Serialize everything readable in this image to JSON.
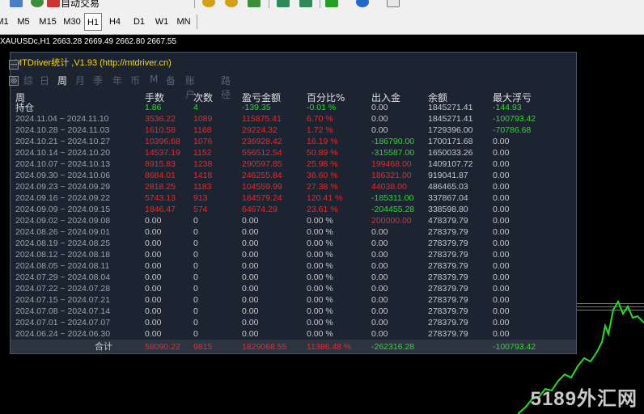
{
  "toolbar": {
    "auto_trading_label": "自动交易",
    "timeframes": [
      "M1",
      "M5",
      "M15",
      "M30",
      "H1",
      "H4",
      "D1",
      "W1",
      "MN"
    ],
    "active_timeframe": "H1",
    "icons": [
      "user-icon",
      "globe-icon",
      "zoom-in-icon",
      "zoom-out-icon",
      "tile-windows-icon",
      "period-separator-icon",
      "chart-shift-icon",
      "add-indicator-icon",
      "clock-icon",
      "template-icon"
    ]
  },
  "chart": {
    "title": "XAUUSDc,H1  2663.28 2669.49 2662.80 2667.55",
    "watermark": "5189外汇网"
  },
  "panel": {
    "title": "MTDriver统计 ,V1.93 (http://mtdriver.cn)",
    "tabs": [
      "综",
      "日",
      "周",
      "月",
      "季",
      "年",
      "币",
      "M",
      "备",
      "账户",
      "路径"
    ],
    "active_tab": "周",
    "headers": [
      "周",
      "手数",
      "次数",
      "盈亏金额",
      "百分比%",
      "出入金",
      "余额",
      "最大浮亏"
    ],
    "holding": {
      "label": "持仓",
      "lots": "1.86",
      "count": "4",
      "pnl": "-139.35",
      "pct": "-0.01 %",
      "flow": "0.00",
      "balance": "1845271.41",
      "maxdd": "-144.93"
    },
    "rows": [
      {
        "week": "2024.11.04 ~ 2024.11.10",
        "lots": "3536.22",
        "count": "1089",
        "pnl": "115875.41",
        "pct": "6.70 %",
        "flow": "0.00",
        "balance": "1845271.41",
        "maxdd": "-100793.42"
      },
      {
        "week": "2024.10.28 ~ 2024.11.03",
        "lots": "1610.58",
        "count": "1168",
        "pnl": "29224.32",
        "pct": "1.72 %",
        "flow": "0.00",
        "balance": "1729396.00",
        "maxdd": "-70786.68"
      },
      {
        "week": "2024.10.21 ~ 2024.10.27",
        "lots": "10396.68",
        "count": "1076",
        "pnl": "236928.42",
        "pct": "16.19 %",
        "flow": "-186790.00",
        "balance": "1700171.68",
        "maxdd": "0.00"
      },
      {
        "week": "2024.10.14 ~ 2024.10.20",
        "lots": "14537.19",
        "count": "1152",
        "pnl": "556512.54",
        "pct": "50.89 %",
        "flow": "-315587.00",
        "balance": "1650033.26",
        "maxdd": "0.00"
      },
      {
        "week": "2024.10.07 ~ 2024.10.13",
        "lots": "8915.83",
        "count": "1238",
        "pnl": "290597.85",
        "pct": "25.98 %",
        "flow": "199468.00",
        "balance": "1409107.72",
        "maxdd": "0.00"
      },
      {
        "week": "2024.09.30 ~ 2024.10.06",
        "lots": "8684.01",
        "count": "1418",
        "pnl": "246255.84",
        "pct": "36.60 %",
        "flow": "186321.00",
        "balance": "919041.87",
        "maxdd": "0.00"
      },
      {
        "week": "2024.09.23 ~ 2024.09.29",
        "lots": "2818.25",
        "count": "1183",
        "pnl": "104559.99",
        "pct": "27.38 %",
        "flow": "44038.00",
        "balance": "486465.03",
        "maxdd": "0.00"
      },
      {
        "week": "2024.09.16 ~ 2024.09.22",
        "lots": "5743.13",
        "count": "913",
        "pnl": "184579.24",
        "pct": "120.41 %",
        "flow": "-185311.00",
        "balance": "337867.04",
        "maxdd": "0.00"
      },
      {
        "week": "2024.09.09 ~ 2024.09.15",
        "lots": "1846.47",
        "count": "574",
        "pnl": "64674.29",
        "pct": "23.61 %",
        "flow": "-204455.28",
        "balance": "338598.80",
        "maxdd": "0.00"
      },
      {
        "week": "2024.09.02 ~ 2024.09.08",
        "lots": "0.00",
        "count": "0",
        "pnl": "0.00",
        "pct": "0.00 %",
        "flow": "200000.00",
        "balance": "478379.79",
        "maxdd": "0.00"
      },
      {
        "week": "2024.08.26 ~ 2024.09.01",
        "lots": "0.00",
        "count": "0",
        "pnl": "0.00",
        "pct": "0.00 %",
        "flow": "0.00",
        "balance": "278379.79",
        "maxdd": "0.00"
      },
      {
        "week": "2024.08.19 ~ 2024.08.25",
        "lots": "0.00",
        "count": "0",
        "pnl": "0.00",
        "pct": "0.00 %",
        "flow": "0.00",
        "balance": "278379.79",
        "maxdd": "0.00"
      },
      {
        "week": "2024.08.12 ~ 2024.08.18",
        "lots": "0.00",
        "count": "0",
        "pnl": "0.00",
        "pct": "0.00 %",
        "flow": "0.00",
        "balance": "278379.79",
        "maxdd": "0.00"
      },
      {
        "week": "2024.08.05 ~ 2024.08.11",
        "lots": "0.00",
        "count": "0",
        "pnl": "0.00",
        "pct": "0.00 %",
        "flow": "0.00",
        "balance": "278379.79",
        "maxdd": "0.00"
      },
      {
        "week": "2024.07.29 ~ 2024.08.04",
        "lots": "0.00",
        "count": "0",
        "pnl": "0.00",
        "pct": "0.00 %",
        "flow": "0.00",
        "balance": "278379.79",
        "maxdd": "0.00"
      },
      {
        "week": "2024.07.22 ~ 2024.07.28",
        "lots": "0.00",
        "count": "0",
        "pnl": "0.00",
        "pct": "0.00 %",
        "flow": "0.00",
        "balance": "278379.79",
        "maxdd": "0.00"
      },
      {
        "week": "2024.07.15 ~ 2024.07.21",
        "lots": "0.00",
        "count": "0",
        "pnl": "0.00",
        "pct": "0.00 %",
        "flow": "0.00",
        "balance": "278379.79",
        "maxdd": "0.00"
      },
      {
        "week": "2024.07.08 ~ 2024.07.14",
        "lots": "0.00",
        "count": "0",
        "pnl": "0.00",
        "pct": "0.00 %",
        "flow": "0.00",
        "balance": "278379.79",
        "maxdd": "0.00"
      },
      {
        "week": "2024.07.01 ~ 2024.07.07",
        "lots": "0.00",
        "count": "0",
        "pnl": "0.00",
        "pct": "0.00 %",
        "flow": "0.00",
        "balance": "278379.79",
        "maxdd": "0.00"
      },
      {
        "week": "2024.06.24 ~ 2024.06.30",
        "lots": "0.00",
        "count": "0",
        "pnl": "0.00",
        "pct": "0.00 %",
        "flow": "0.00",
        "balance": "278379.79",
        "maxdd": "0.00"
      }
    ],
    "totals": {
      "label": "合计",
      "lots": "58090.22",
      "count": "9815",
      "pnl": "1829068.55",
      "pct": "11386.48 %",
      "flow": "-262316.28",
      "maxdd": "-100793.42"
    }
  },
  "colors": {
    "positive": "#ff2020",
    "negative": "#22e022",
    "neutral": "#c8c8c8",
    "title": "#ffd900",
    "panel_bg": "#1b2430"
  }
}
